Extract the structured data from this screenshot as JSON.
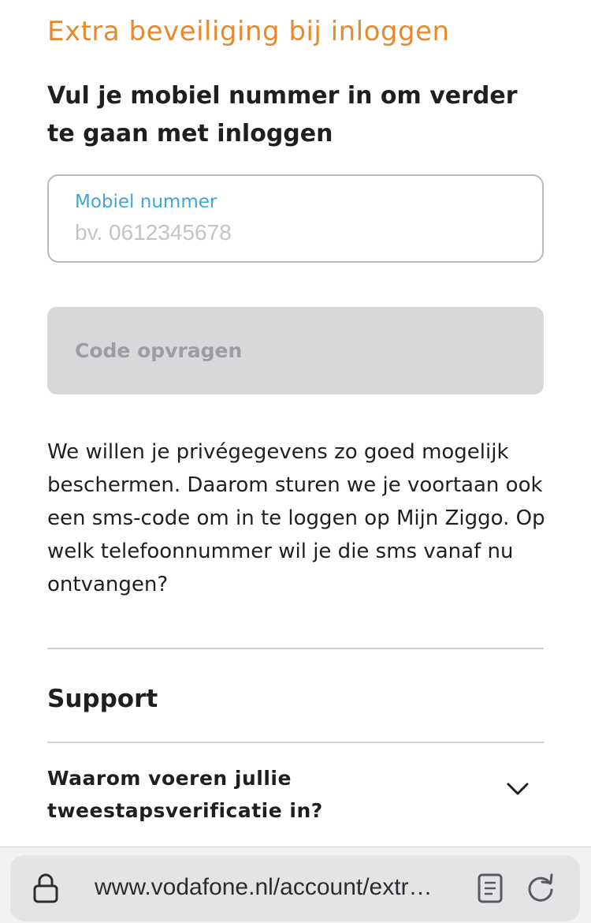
{
  "page": {
    "title": "Extra beveiliging bij inloggen",
    "subtitle": "Vul je mobiel nummer in om verder te gaan met inloggen"
  },
  "form": {
    "phone_label": "Mobiel nummer",
    "phone_placeholder": "bv. 0612345678",
    "phone_value": "",
    "submit_label": "Code opvragen",
    "submit_enabled": false
  },
  "info_text": "We willen je privégegevens zo goed mogelijk beschermen. Daarom sturen we je voortaan ook een sms-code om in te loggen op Mijn Ziggo. Op welk telefoonnummer wil je die sms vanaf nu ontvangen?",
  "support": {
    "heading": "Support",
    "faq": [
      {
        "question": "Waarom voeren jullie tweestapsverificatie in?",
        "expanded": false,
        "icon": "chevron-down-icon"
      }
    ]
  },
  "browser": {
    "url": "www.vodafone.nl/account/extr…",
    "icons": [
      "lock-icon",
      "reader-icon",
      "reload-icon"
    ]
  },
  "colors": {
    "title": "#e68a2e",
    "label": "#3fa5d6",
    "button_disabled_bg": "#d8d8db",
    "button_disabled_text": "#9d9da1"
  }
}
